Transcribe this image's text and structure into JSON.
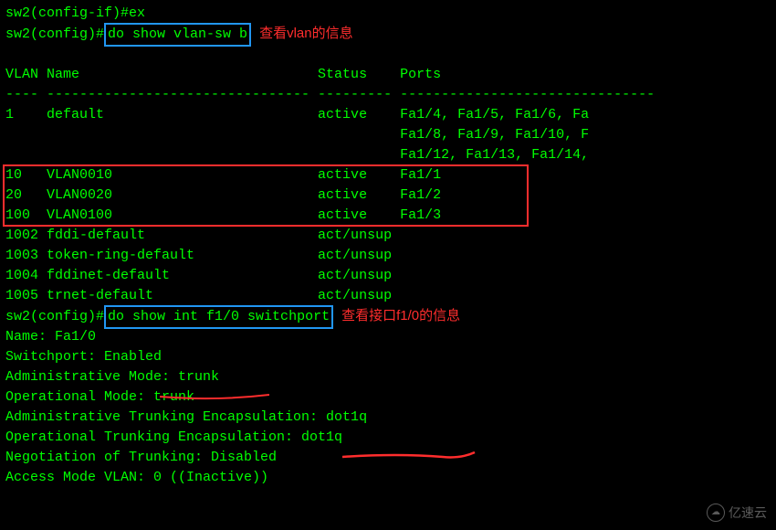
{
  "lines": {
    "l0": "sw2(config-if)#ex",
    "l1_prompt": "sw2(config)#",
    "l1_cmd": "do show vlan-sw b",
    "l1_note": "查看vlan的信息",
    "blank": " ",
    "header": "VLAN Name                             Status    Ports",
    "dash": "---- -------------------------------- --------- -------------------------------",
    "r_default": "1    default                          active    Fa1/4, Fa1/5, Fa1/6, Fa",
    "r_default2": "                                                Fa1/8, Fa1/9, Fa1/10, F",
    "r_default3": "                                                Fa1/12, Fa1/13, Fa1/14,",
    "r_v10": "10   VLAN0010                         active    Fa1/1",
    "r_v20": "20   VLAN0020                         active    Fa1/2",
    "r_v100": "100  VLAN0100                         active    Fa1/3",
    "r_1002": "1002 fddi-default                     act/unsup ",
    "r_1003": "1003 token-ring-default               act/unsup ",
    "r_1004": "1004 fddinet-default                  act/unsup ",
    "r_1005": "1005 trnet-default                    act/unsup ",
    "l2_prompt": "sw2(config)#",
    "l2_cmd": "do show int f1/0 switchport",
    "l2_note": "查看接口f1/0的信息",
    "sp_name": "Name: Fa1/0",
    "sp_sw": "Switchport: Enabled",
    "sp_admin": "Administrative Mode: trunk",
    "sp_oper": "Operational Mode: trunk",
    "sp_adm_tr": "Administrative Trunking Encapsulation: dot1q",
    "sp_oper_tr": "Operational Trunking Encapsulation: dot1q",
    "sp_neg": "Negotiation of Trunking: Disabled",
    "sp_acc": "Access Mode VLAN: 0 ((Inactive))"
  },
  "chart_data": {
    "type": "table",
    "title": "show vlan-sw b",
    "columns": [
      "VLAN",
      "Name",
      "Status",
      "Ports"
    ],
    "rows": [
      {
        "VLAN": 1,
        "Name": "default",
        "Status": "active",
        "Ports": "Fa1/4, Fa1/5, Fa1/6, Fa1/8, Fa1/9, Fa1/10, Fa1/12, Fa1/13, Fa1/14"
      },
      {
        "VLAN": 10,
        "Name": "VLAN0010",
        "Status": "active",
        "Ports": "Fa1/1"
      },
      {
        "VLAN": 20,
        "Name": "VLAN0020",
        "Status": "active",
        "Ports": "Fa1/2"
      },
      {
        "VLAN": 100,
        "Name": "VLAN0100",
        "Status": "active",
        "Ports": "Fa1/3"
      },
      {
        "VLAN": 1002,
        "Name": "fddi-default",
        "Status": "act/unsup",
        "Ports": ""
      },
      {
        "VLAN": 1003,
        "Name": "token-ring-default",
        "Status": "act/unsup",
        "Ports": ""
      },
      {
        "VLAN": 1004,
        "Name": "fddinet-default",
        "Status": "act/unsup",
        "Ports": ""
      },
      {
        "VLAN": 1005,
        "Name": "trnet-default",
        "Status": "act/unsup",
        "Ports": ""
      }
    ]
  },
  "watermark": "亿速云"
}
